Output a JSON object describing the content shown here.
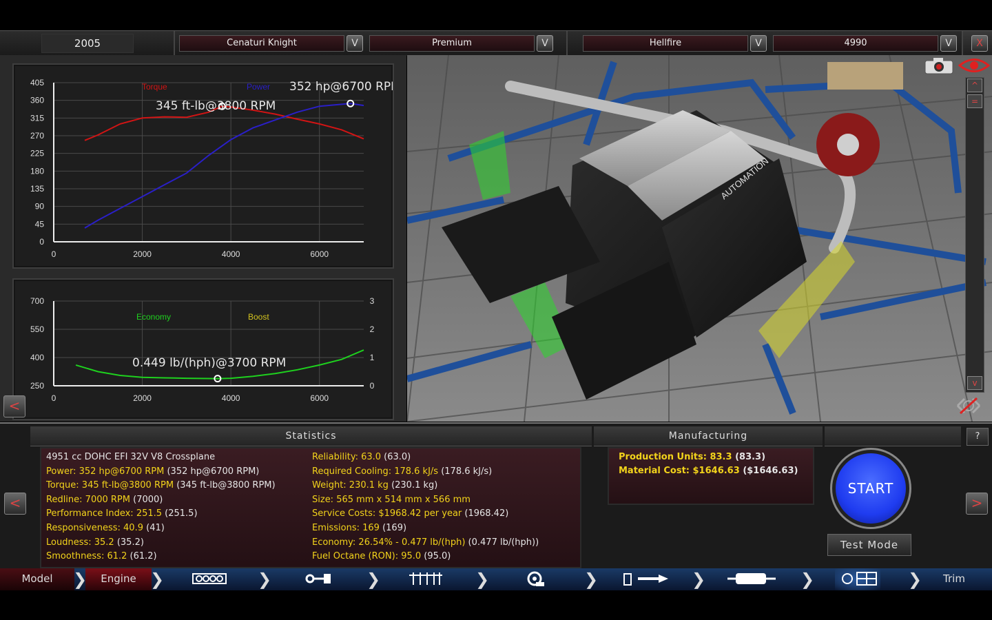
{
  "top": {
    "year": "2005",
    "model": "Cenaturi Knight",
    "trim": "Premium",
    "engine_family": "Hellfire",
    "engine_variant": "4990",
    "dropdown_glyph": "V",
    "close_glyph": "X"
  },
  "chart_data": [
    {
      "type": "line",
      "xlim": [
        0,
        7000
      ],
      "ylim": [
        0,
        405
      ],
      "x_ticks": [
        "0",
        "2000",
        "4000",
        "6000"
      ],
      "y_ticks": [
        "405",
        "360",
        "315",
        "270",
        "225",
        "180",
        "135",
        "90",
        "45",
        "0"
      ],
      "series": [
        {
          "name": "Torque",
          "color": "#d21414",
          "x": [
            700,
            1000,
            1500,
            2000,
            2500,
            3000,
            3500,
            3800,
            4000,
            4500,
            5000,
            5500,
            6000,
            6500,
            7000
          ],
          "y": [
            258,
            272,
            300,
            315,
            318,
            317,
            330,
            345,
            343,
            335,
            325,
            312,
            300,
            285,
            262
          ]
        },
        {
          "name": "Power",
          "color": "#2a1fc8",
          "x": [
            700,
            1000,
            1500,
            2000,
            2500,
            3000,
            3500,
            4000,
            4500,
            5000,
            5500,
            6000,
            6500,
            6700,
            7000
          ],
          "y": [
            35,
            55,
            85,
            115,
            145,
            175,
            220,
            260,
            290,
            310,
            330,
            345,
            350,
            352,
            347
          ]
        }
      ],
      "annotations": [
        {
          "text": "352 hp@6700 RPM",
          "x": 6700,
          "y": 352
        },
        {
          "text": "345 ft-lb@3800 RPM",
          "x": 3800,
          "y": 345
        }
      ],
      "grid": true
    },
    {
      "type": "line",
      "xlim": [
        0,
        7000
      ],
      "ylim": [
        250,
        700
      ],
      "y2lim": [
        0,
        3
      ],
      "x_ticks": [
        "0",
        "2000",
        "4000",
        "6000"
      ],
      "y_ticks": [
        "700",
        "550",
        "400",
        "250"
      ],
      "y2_ticks": [
        "3",
        "2",
        "1",
        "0"
      ],
      "series": [
        {
          "name": "Economy",
          "color": "#1ed21e",
          "x": [
            500,
            1000,
            1500,
            2000,
            2500,
            3000,
            3700,
            4000,
            4500,
            5000,
            5500,
            6000,
            6500,
            7000
          ],
          "y": [
            360,
            325,
            305,
            295,
            292,
            290,
            288,
            290,
            300,
            315,
            335,
            360,
            390,
            440
          ]
        },
        {
          "name": "Boost",
          "color": "#d2c21e",
          "x": [],
          "y": []
        }
      ],
      "annotations": [
        {
          "text": "0.449 lb/(hph)@3700 RPM",
          "x": 3700,
          "y": 288
        }
      ],
      "grid": true
    }
  ],
  "view_controls": {
    "up_glyph": "^",
    "down_glyph": "v",
    "menu_glyph": "="
  },
  "stats": {
    "title": "Statistics",
    "left": [
      {
        "label": "4951 cc DOHC EFI 32V V8 Crossplane",
        "value": ""
      },
      {
        "label": "Power: 352 hp@6700 RPM",
        "value": "(352 hp@6700 RPM)"
      },
      {
        "label": "Torque: 345 ft-lb@3800 RPM",
        "value": "(345 ft-lb@3800 RPM)"
      },
      {
        "label": "Redline: 7000 RPM",
        "value": "(7000)"
      },
      {
        "label": "Performance Index: 251.5",
        "value": "(251.5)"
      },
      {
        "label": "Responsiveness: 40.9",
        "value": "(41)"
      },
      {
        "label": "Loudness: 35.2",
        "value": "(35.2)"
      },
      {
        "label": "Smoothness: 61.2",
        "value": "(61.2)"
      }
    ],
    "right": [
      {
        "label": "Reliability: 63.0",
        "value": "(63.0)"
      },
      {
        "label": "Required Cooling: 178.6 kJ/s",
        "value": "(178.6 kJ/s)"
      },
      {
        "label": "Weight: 230.1 kg",
        "value": "(230.1 kg)"
      },
      {
        "label": "Size: 565 mm x 514 mm x 566 mm",
        "value": ""
      },
      {
        "label": "Service Costs: $1968.42 per year",
        "value": "(1968.42)"
      },
      {
        "label": "Emissions: 169",
        "value": "(169)"
      },
      {
        "label": "Economy: 26.54% - 0.477 lb/(hph)",
        "value": "(0.477 lb/(hph))"
      },
      {
        "label": "Fuel Octane (RON): 95.0",
        "value": "(95.0)"
      }
    ]
  },
  "manufacturing": {
    "title": "Manufacturing",
    "units_label": "Production Units: 83.3",
    "units_value": "(83.3)",
    "cost_label": "Material Cost: $1646.63",
    "cost_value": "($1646.63)"
  },
  "actions": {
    "start": "START",
    "test_mode": "Test Mode",
    "help": "?",
    "prev_glyph": "<",
    "next_glyph": ">"
  },
  "nav": {
    "model": "Model",
    "engine": "Engine",
    "trim": "Trim",
    "icons": [
      "block-icon",
      "crank-icon",
      "heads-icon",
      "turbo-icon",
      "fuel-icon",
      "exhaust-icon",
      "dyno-icon"
    ]
  },
  "colors": {
    "torque": "#d21414",
    "power": "#2a1fc8",
    "economy": "#1ed21e",
    "boost": "#d2c21e",
    "stat_yellow": "#f2d31b",
    "start_blue": "#1f3cf0"
  },
  "engine_logo": "AUTOMATION"
}
